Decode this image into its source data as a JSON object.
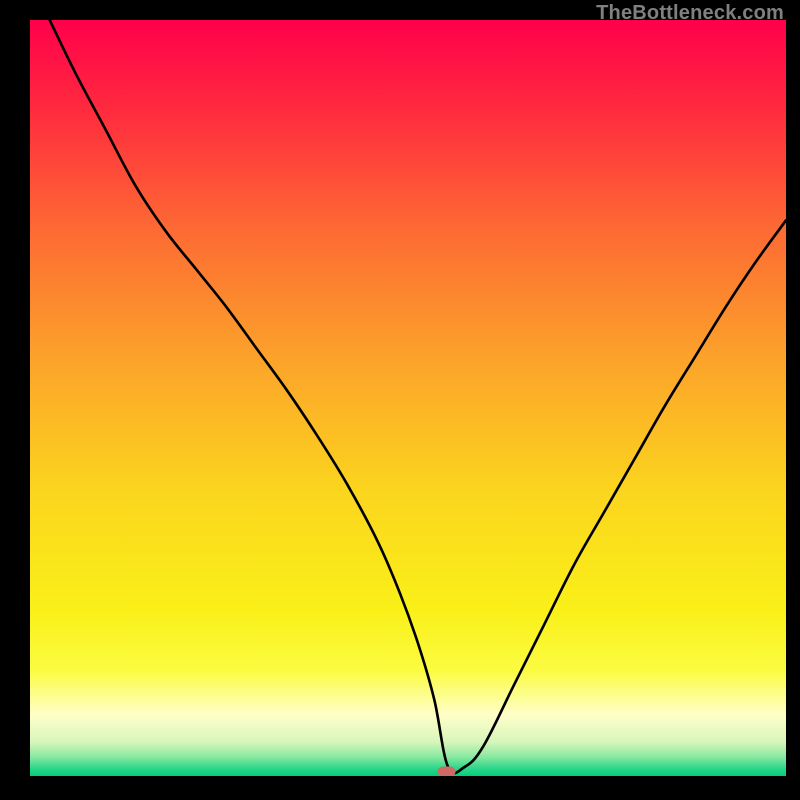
{
  "watermark": "TheBottleneck.com",
  "chart_data": {
    "type": "line",
    "title": "",
    "xlabel": "",
    "ylabel": "",
    "xlim": [
      0,
      100
    ],
    "ylim": [
      0,
      100
    ],
    "grid": false,
    "legend": false,
    "annotations": [
      {
        "name": "optimal-marker",
        "x": 55.1,
        "y": 0.6,
        "color": "#cf6a63"
      }
    ],
    "background_gradient_stops": [
      {
        "pos": 0.0,
        "color": "#ff004b"
      },
      {
        "pos": 0.12,
        "color": "#ff2b3e"
      },
      {
        "pos": 0.28,
        "color": "#fd6b33"
      },
      {
        "pos": 0.45,
        "color": "#fca32a"
      },
      {
        "pos": 0.62,
        "color": "#fbd41e"
      },
      {
        "pos": 0.78,
        "color": "#faf018"
      },
      {
        "pos": 0.86,
        "color": "#fbfb41"
      },
      {
        "pos": 0.92,
        "color": "#feffc9"
      },
      {
        "pos": 0.955,
        "color": "#d7f6ba"
      },
      {
        "pos": 0.975,
        "color": "#87e9a0"
      },
      {
        "pos": 0.99,
        "color": "#2bd68a"
      },
      {
        "pos": 1.0,
        "color": "#05ce7b"
      }
    ],
    "series": [
      {
        "name": "bottleneck-curve",
        "x": [
          2.6,
          6,
          10,
          14,
          18,
          22,
          26,
          30,
          34,
          38,
          42,
          46,
          49,
          51.5,
          53.5,
          55.3,
          57.5,
          60,
          64,
          68,
          72,
          76,
          80,
          84,
          88,
          92,
          96,
          100
        ],
        "y": [
          100,
          93,
          85.5,
          78,
          72,
          67,
          62,
          56.5,
          51,
          45,
          38.5,
          31,
          24,
          17,
          10,
          1.2,
          1.2,
          4,
          12,
          20,
          28,
          35,
          42,
          49,
          55.5,
          62,
          68,
          73.5
        ]
      }
    ]
  }
}
